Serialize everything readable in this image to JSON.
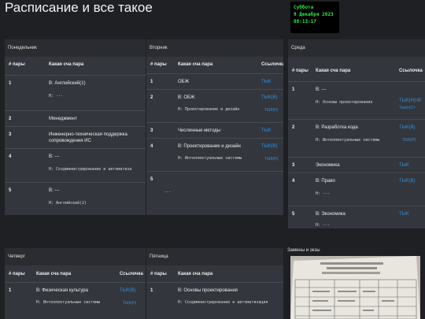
{
  "page": {
    "title": "Расписание и все такое"
  },
  "clock": {
    "day": "Суббота",
    "date": "9 Декабря 2023",
    "time": "08:13:17"
  },
  "cols": {
    "num": "# пары",
    "subject": "Какая сча пара",
    "link": "Ссылочка"
  },
  "days": {
    "mon": {
      "name": "Понедельник",
      "rows": [
        {
          "n": "1",
          "main": "В: Английский(1)",
          "sub": "Н: ---"
        },
        {
          "n": "2",
          "main": "Менеджмент",
          "sub": ""
        },
        {
          "n": "3",
          "main": "Инженерно-техническая поддержка сопровождения ИС",
          "sub": ""
        },
        {
          "n": "4",
          "main": "В: ---",
          "sub": "Н: Создминистрирование и автоматиза"
        },
        {
          "n": "5",
          "main": "В: ---",
          "sub": "Н: Английский(2)"
        }
      ]
    },
    "tue": {
      "name": "Вторник",
      "rows": [
        {
          "n": "1",
          "main": "ОБЖ",
          "sub": "",
          "link": "ТЫК",
          "link2": ""
        },
        {
          "n": "2",
          "main": "В: ОБЖ",
          "sub": "Н: Проектирование и дизайн",
          "link": "ТЫК(В)",
          "link2": "ТЫК(Н)"
        },
        {
          "n": "3",
          "main": "Численные методы",
          "sub": "",
          "link": "ТЫК",
          "link2": ""
        },
        {
          "n": "4",
          "main": "В: Проектирование и дизайн",
          "sub": "Н: Интеллектуальные системы",
          "link": "ТЫК(В)",
          "link2": "ТЫК(Н)"
        },
        {
          "n": "5",
          "main": "",
          "sub": "---",
          "link": "",
          "link2": ""
        }
      ]
    },
    "wed": {
      "name": "Среда",
      "rows": [
        {
          "n": "1",
          "main": "В: ---",
          "sub": "Н: Основы проектирования",
          "link": "ТЫК(Н)ЧЕ",
          "link2": "Тык(н)Ст"
        },
        {
          "n": "2",
          "main": "В: Разработка кода",
          "sub": "Н: Интеллектуальные системы",
          "link": "ТЫК(В)",
          "link2": "ТЫК(Н)"
        },
        {
          "n": "3",
          "main": "Экономика",
          "sub": "",
          "link": "ТЫК",
          "link2": ""
        },
        {
          "n": "4",
          "main": "В: Право",
          "sub": "Н: ---",
          "link": "ТЫК(В)",
          "link2": ""
        },
        {
          "n": "5",
          "main": "В: Экономика",
          "sub": "Н: ---",
          "link": "ТЫК",
          "link2": ""
        }
      ]
    },
    "thu": {
      "name": "Четверг",
      "rows": [
        {
          "n": "1",
          "main": "В: Физическая культура",
          "sub": "Н: Интеллектуальные системы",
          "link": "ТЫК(В)",
          "link2": "ТЫК(Н)"
        }
      ]
    },
    "fri": {
      "name": "Пятница",
      "rows": [
        {
          "n": "1",
          "main": "В: Основы проектирования",
          "sub": "Н: Создминистрирование и автоматизация"
        }
      ]
    }
  },
  "exams": {
    "label": "Замены и экзы"
  },
  "colors": {
    "clock_text": "#2ee84a",
    "link": "#2f8fe0",
    "panel": "#33363c",
    "background": "#1e2024"
  }
}
